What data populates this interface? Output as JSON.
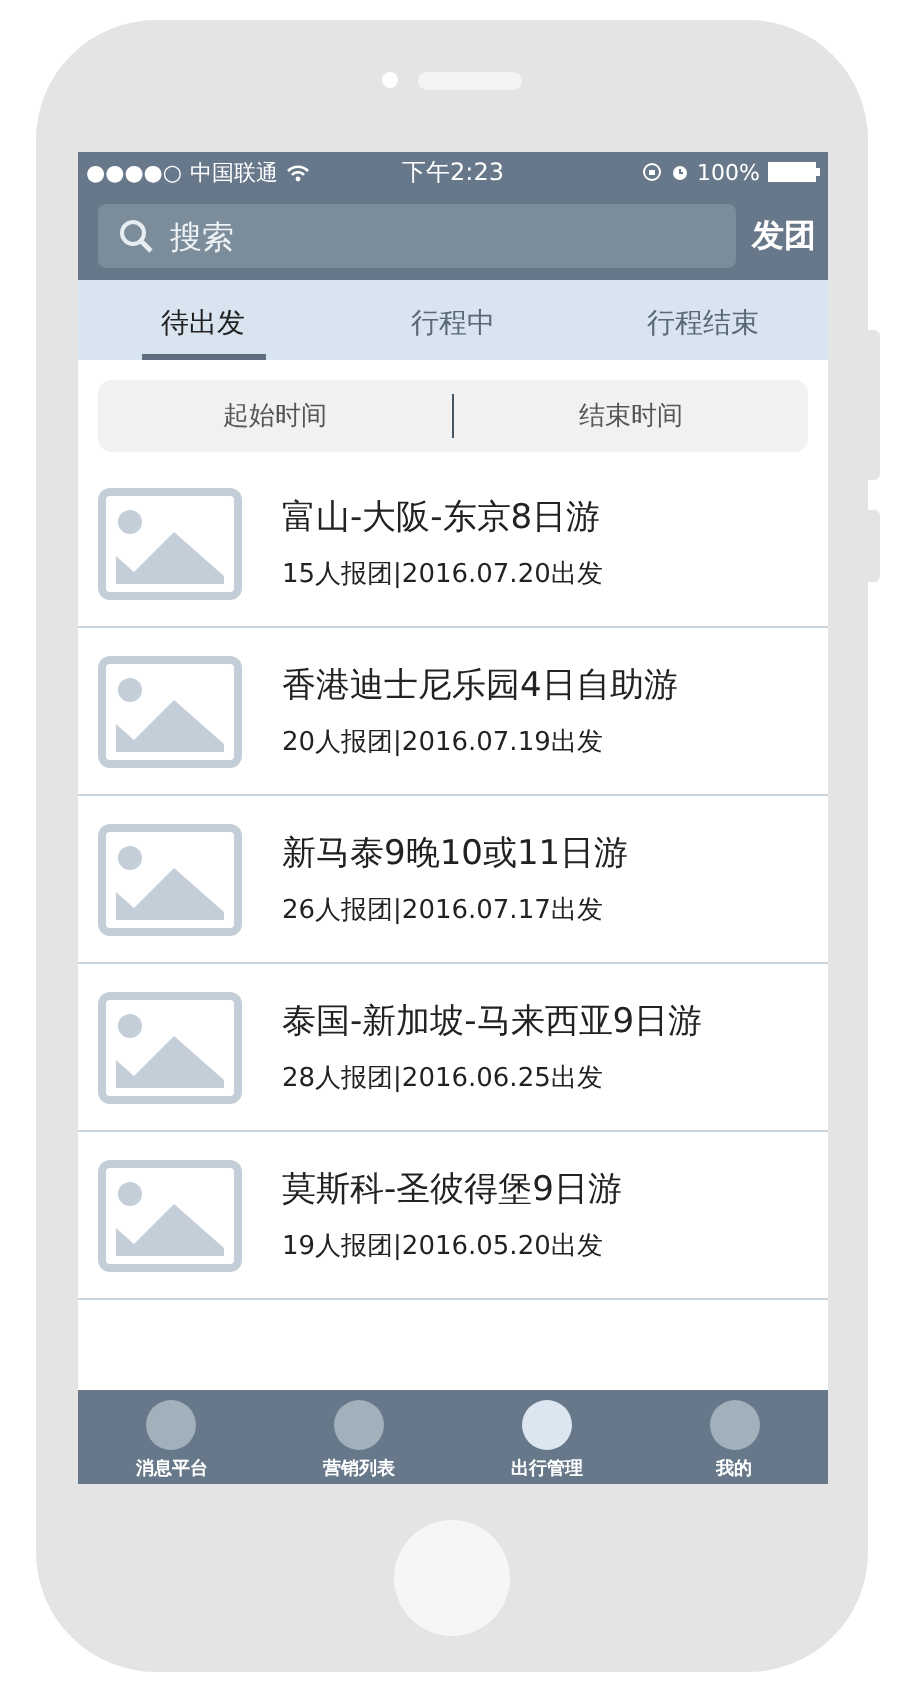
{
  "status_bar": {
    "signal": "●●●●○",
    "carrier": "中国联通",
    "time": "下午2:23",
    "battery": "100%"
  },
  "search": {
    "placeholder": "搜索",
    "action": "发团"
  },
  "tabs": [
    {
      "label": "待出发",
      "selected": true
    },
    {
      "label": "行程中",
      "selected": false
    },
    {
      "label": "行程结束",
      "selected": false
    }
  ],
  "filter": {
    "start": "起始时间",
    "end": "结束时间"
  },
  "trips": [
    {
      "title": "富山-大阪-东京8日游",
      "meta": "15人报团|2016.07.20出发"
    },
    {
      "title": "香港迪士尼乐园4日自助游",
      "meta": "20人报团|2016.07.19出发"
    },
    {
      "title": "新马泰9晚10或11日游",
      "meta": "26人报团|2016.07.17出发"
    },
    {
      "title": "泰国-新加坡-马来西亚9日游",
      "meta": "28人报团|2016.06.25出发"
    },
    {
      "title": "莫斯科-圣彼得堡9日游",
      "meta": "19人报团|2016.05.20出发"
    }
  ],
  "tab_bar": [
    {
      "label": "消息平台",
      "selected": false
    },
    {
      "label": "营销列表",
      "selected": false
    },
    {
      "label": "出行管理",
      "selected": true
    },
    {
      "label": "我的",
      "selected": false
    }
  ]
}
